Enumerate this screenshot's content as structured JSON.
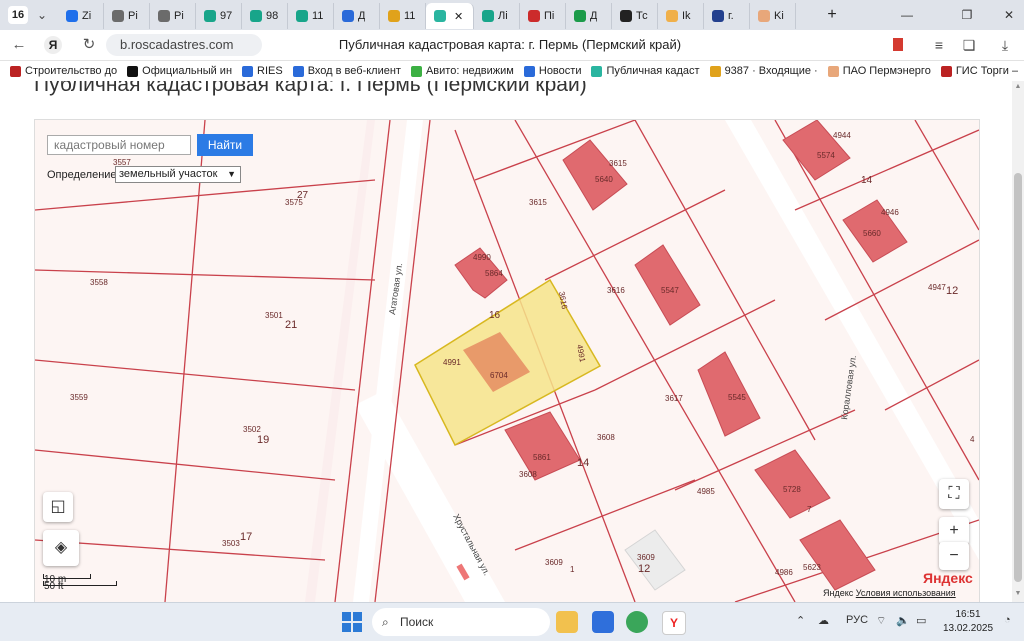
{
  "browser": {
    "tab_count": "16",
    "tabs": [
      {
        "label": "Zi",
        "color": "#1f6feb"
      },
      {
        "label": "Pi",
        "color": "#6b6b6b"
      },
      {
        "label": "Pi",
        "color": "#6b6b6b"
      },
      {
        "label": "97",
        "color": "#18a58a"
      },
      {
        "label": "98",
        "color": "#18a58a"
      },
      {
        "label": "11",
        "color": "#18a58a"
      },
      {
        "label": "Д",
        "color": "#2a6ad9"
      },
      {
        "label": "11",
        "color": "#e0a21b"
      },
      {
        "label": "",
        "color": "#2ab5a0",
        "active": true
      },
      {
        "label": "Лі",
        "color": "#18a58a"
      },
      {
        "label": "Пі",
        "color": "#cc2b2b"
      },
      {
        "label": "Д",
        "color": "#1c9b4a"
      },
      {
        "label": "Тс",
        "color": "#222222"
      },
      {
        "label": "Ik",
        "color": "#f0b04a"
      },
      {
        "label": "г.",
        "color": "#23408e"
      },
      {
        "label": "Ki",
        "color": "#e8a77a"
      }
    ],
    "url": "b.roscadastres.com",
    "page_title": "Публичная кадастровая карта: г. Пермь (Пермский край)",
    "bookmarks": [
      {
        "label": "Строительство до",
        "color": "#b22"
      },
      {
        "label": "Официальный ин",
        "color": "#111"
      },
      {
        "label": "RIES",
        "color": "#2a6ad9"
      },
      {
        "label": "Вход в веб-клиент",
        "color": "#2a6ad9"
      },
      {
        "label": "Авито: недвижим",
        "color": "#3cb043"
      },
      {
        "label": "Новости",
        "color": "#2a6ad9"
      },
      {
        "label": "Публичная кадаст",
        "color": "#2ab5a0"
      },
      {
        "label": "9387 · Входящие ·",
        "color": "#e0a21b"
      },
      {
        "label": "ПАО Пермэнерго",
        "color": "#e8a77a"
      },
      {
        "label": "ГИС Торги –",
        "color": "#b22"
      }
    ]
  },
  "page": {
    "heading": "Публичная кадастровая карта: г. Пермь (Пермский край)"
  },
  "map": {
    "search_placeholder": "кадастровый номер",
    "find_button": "Найти",
    "definition_label": "Определение:",
    "definition_value": "земельный участок",
    "scale_m": "10 m",
    "scale_ft": "50 ft",
    "provider": "Яндекс",
    "terms_prefix": "Яндекс",
    "terms_link": "Условия использования",
    "zoom_in": "+",
    "zoom_out": "−",
    "fullscreen": "⛶",
    "streets": {
      "agatovaya": "Агатовая ул.",
      "korallovaya": "Коралловая ул.",
      "khrustalnaya": "Хрустальная ул."
    },
    "labels": {
      "l3557": "3557",
      "l3575": "3575",
      "l27": "27",
      "l3558": "3558",
      "l3501": "3501",
      "l21": "21",
      "l3559": "3559",
      "l3502": "3502",
      "l19": "19",
      "l3503": "3503",
      "l17": "17",
      "l4990": "4990",
      "l5864": "5864",
      "l16": "16",
      "l3615a": "3615",
      "l3615b": "3615",
      "l5640": "5640",
      "l3616a": "3616",
      "l3616b": "3616",
      "l5547": "5547",
      "l4991a": "4991",
      "l4991b": "4991",
      "l6704": "6704",
      "l3617": "3617",
      "l5545": "5545",
      "l3608a": "3608",
      "l3608b": "3608",
      "l5861": "5861",
      "l14a": "14",
      "l4985": "4985",
      "l5728": "5728",
      "l3609a": "3609",
      "l3609b": "3609",
      "l12a": "12",
      "l1": "1",
      "l4986": "4986",
      "l5623": "5623",
      "l4944": "4944",
      "l5574": "5574",
      "l14b": "14",
      "l4946": "4946",
      "l5660": "5660",
      "l4947": "4947",
      "l12b": "12",
      "l4": "4",
      "l7": "7"
    }
  },
  "taskbar": {
    "search_label": "Поиск",
    "lang": "РУС",
    "time": "16:51",
    "date": "13.02.2025"
  }
}
